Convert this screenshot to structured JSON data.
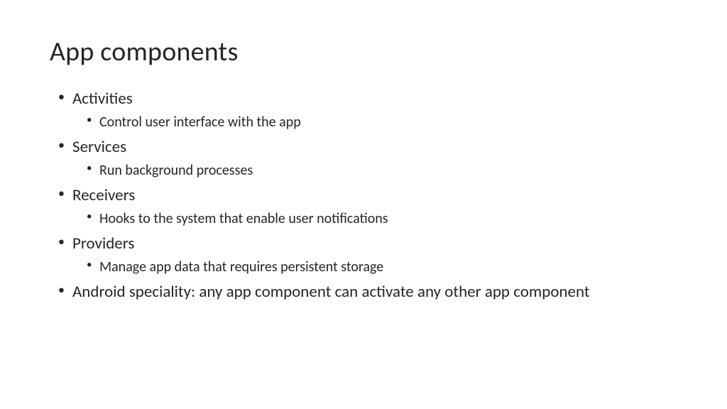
{
  "slide": {
    "title": "App components",
    "bullets": {
      "item0": {
        "label": "Activities",
        "sub0": "Control user interface with the app"
      },
      "item1": {
        "label": "Services",
        "sub0": "Run background processes"
      },
      "item2": {
        "label": "Receivers",
        "sub0": "Hooks to the system that enable user notifications"
      },
      "item3": {
        "label": "Providers",
        "sub0": "Manage app data that requires persistent storage"
      },
      "item4": {
        "label": "Android speciality: any app component can activate any other app component"
      }
    }
  }
}
